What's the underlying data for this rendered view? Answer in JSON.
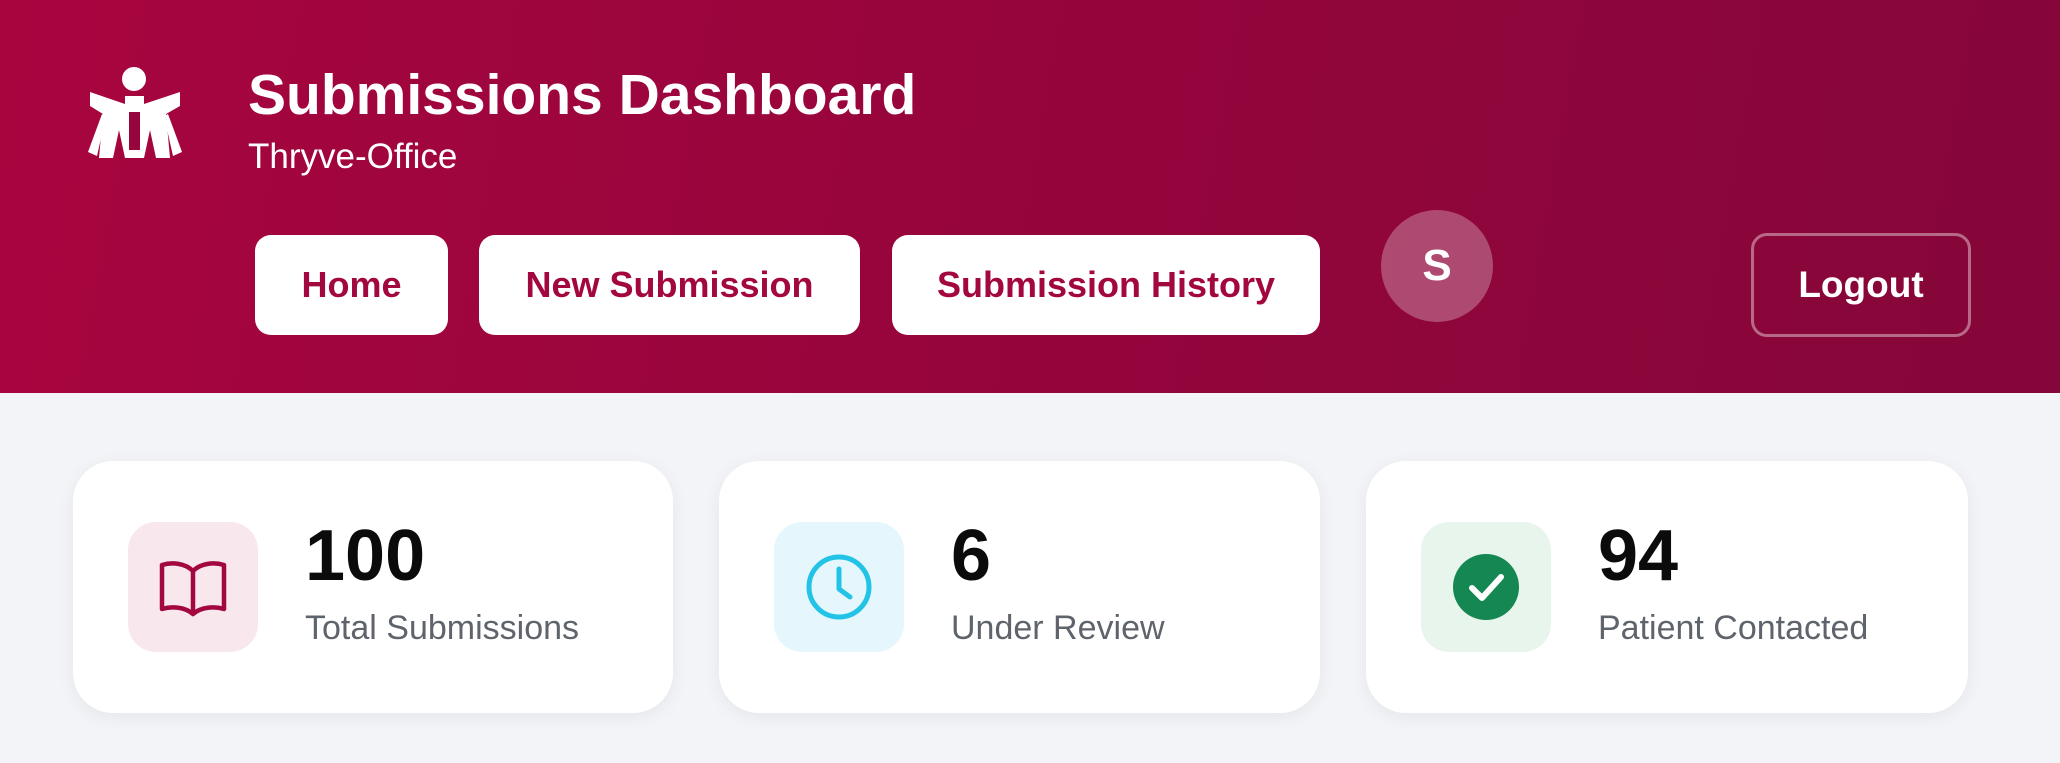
{
  "header": {
    "title": "Submissions Dashboard",
    "subtitle": "Thryve-Office",
    "logo_icon": "stylized-figure-logo",
    "gradient_colors": [
      "#a8053f",
      "#85063a"
    ]
  },
  "nav": {
    "items": [
      {
        "label": "Home"
      },
      {
        "label": "New Submission"
      },
      {
        "label": "Submission History"
      }
    ],
    "avatar_initial": "S",
    "logout_label": "Logout"
  },
  "stats": [
    {
      "value": "100",
      "label": "Total Submissions",
      "icon": "book-icon",
      "icon_color": "#a3073f",
      "icon_bg": "#f8e8ee"
    },
    {
      "value": "6",
      "label": "Under Review",
      "icon": "clock-icon",
      "icon_color": "#22c3e6",
      "icon_bg": "#e5f7fd"
    },
    {
      "value": "94",
      "label": "Patient Contacted",
      "icon": "check-circle-icon",
      "icon_color": "#158752",
      "icon_bg": "#e7f5ec"
    }
  ]
}
